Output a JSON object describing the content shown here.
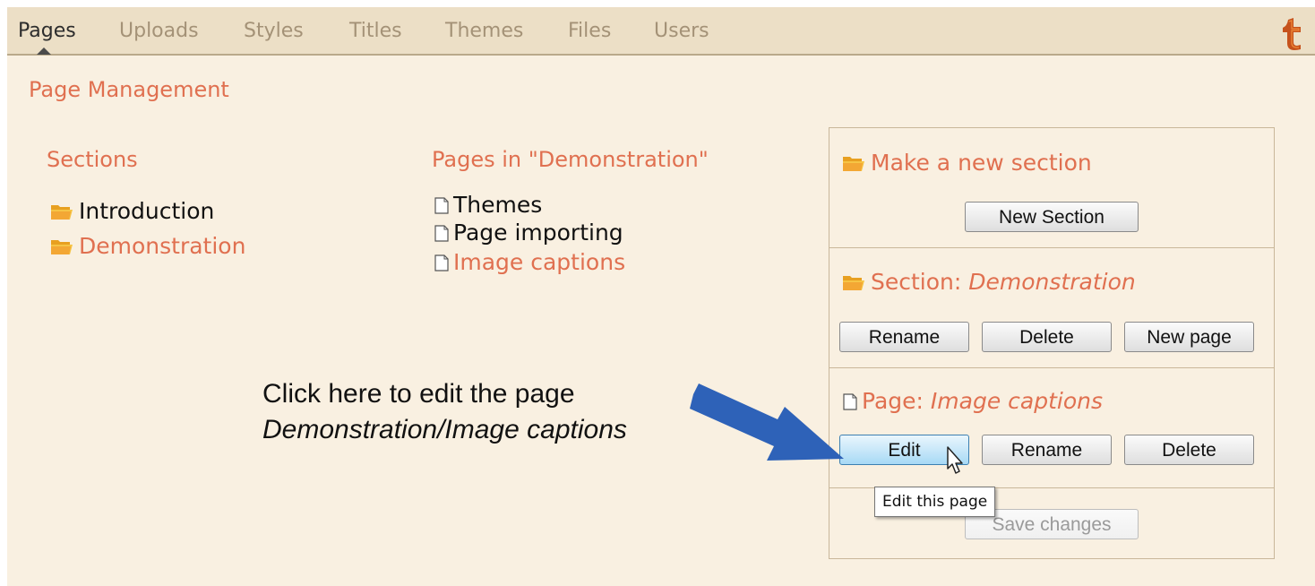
{
  "tabs": [
    {
      "label": "Pages",
      "active": true
    },
    {
      "label": "Uploads"
    },
    {
      "label": "Styles"
    },
    {
      "label": "Titles"
    },
    {
      "label": "Themes"
    },
    {
      "label": "Files"
    },
    {
      "label": "Users"
    }
  ],
  "page_title": "Page Management",
  "sections": {
    "title": "Sections",
    "items": [
      {
        "label": "Introduction",
        "icon": "folder-icon"
      },
      {
        "label": "Demonstration",
        "icon": "folder-icon",
        "selected": true
      }
    ]
  },
  "pages": {
    "title": "Pages in \"Demonstration\"",
    "items": [
      {
        "label": "Themes",
        "icon": "page-icon"
      },
      {
        "label": "Page importing",
        "icon": "page-icon"
      },
      {
        "label": "Image captions",
        "icon": "page-icon",
        "selected": true
      }
    ]
  },
  "panel": {
    "new_section": {
      "heading": "Make a new section",
      "button": "New Section"
    },
    "section": {
      "prefix": "Section: ",
      "name": "Demonstration",
      "rename": "Rename",
      "delete": "Delete",
      "new_page": "New page"
    },
    "page": {
      "prefix": "Page: ",
      "name": "Image captions",
      "edit": "Edit",
      "rename": "Rename",
      "delete": "Delete"
    },
    "save": "Save changes"
  },
  "annotation": {
    "line1": "Click here to edit the page",
    "line2": "Demonstration/Image captions"
  },
  "tooltip": "Edit this page",
  "colors": {
    "accent": "#e07050",
    "arrow": "#2e62b8",
    "background": "#f9f0e1",
    "tabbar": "#ecdfc6"
  }
}
